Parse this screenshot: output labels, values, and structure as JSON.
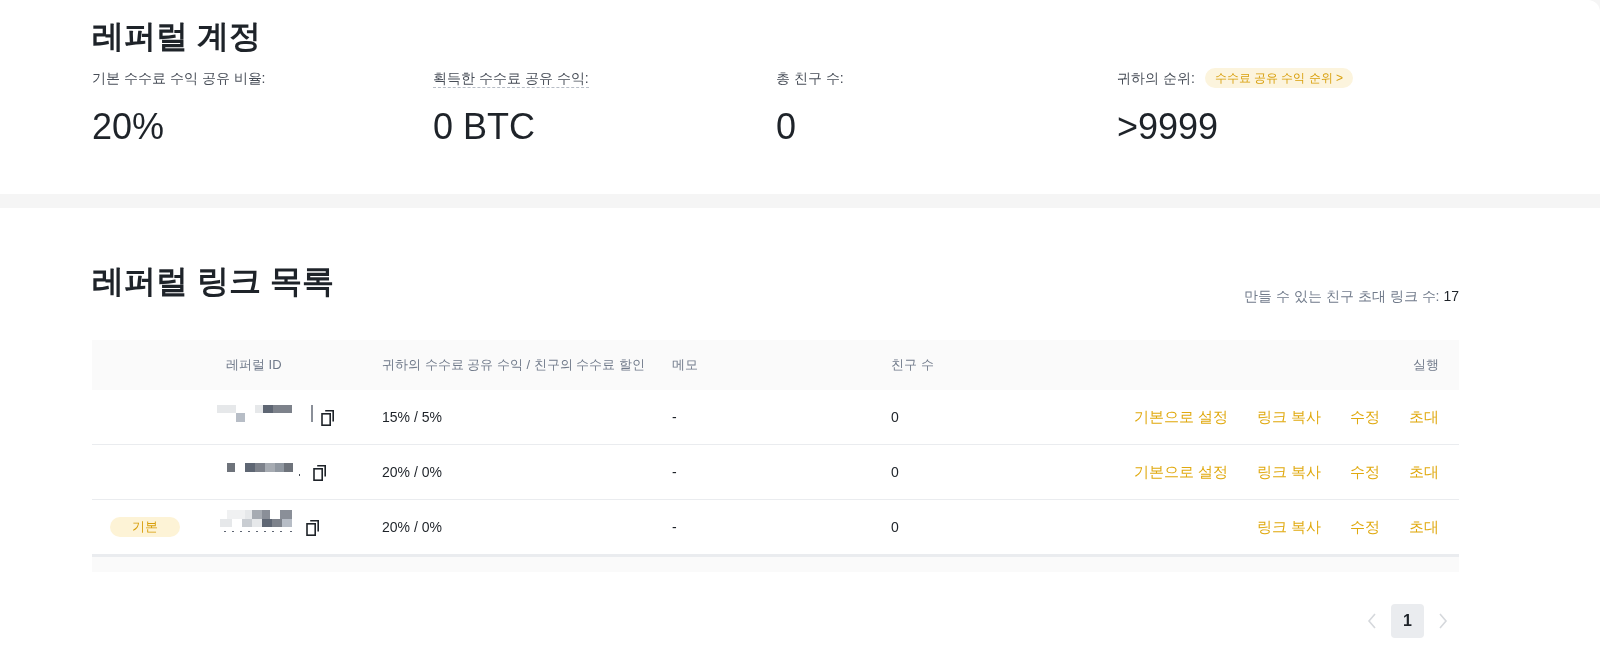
{
  "account": {
    "title": "레퍼럴 계정",
    "stats": [
      {
        "label": "기본 수수료 수익 공유 비율:",
        "value": "20%",
        "underlined": false
      },
      {
        "label": "획득한 수수료 공유 수익:",
        "value": "0 BTC",
        "underlined": true
      },
      {
        "label": "총 친구 수:",
        "value": "0",
        "underlined": false
      },
      {
        "label": "귀하의 순위:",
        "value": ">9999",
        "underlined": false,
        "badge": "수수료 공유 수익 순위 >"
      }
    ]
  },
  "link_list": {
    "title": "레퍼럴 링크 목록",
    "limit_label": "만들 수 있는 친구 초대 링크 수:",
    "limit_value": "17"
  },
  "table": {
    "columns": [
      "레퍼럴 ID",
      "귀하의 수수료 공유 수익 / 친구의 수수료 할인",
      "메모",
      "친구 수",
      "실행"
    ],
    "rows": [
      {
        "rate": "15% / 5%",
        "memo": "-",
        "friends": "0",
        "actions": [
          "기본으로 설정",
          "링크 복사",
          "수정",
          "초대"
        ]
      },
      {
        "rate": "20% / 0%",
        "memo": "-",
        "friends": "0",
        "actions": [
          "기본으로 설정",
          "링크 복사",
          "수정",
          "초대"
        ]
      },
      {
        "tag": "기본",
        "rate": "20% / 0%",
        "memo": "-",
        "friends": "0",
        "actions": [
          "링크 복사",
          "수정",
          "초대"
        ]
      }
    ]
  },
  "pagination": {
    "pages": [
      {
        "label": "1",
        "selected": true
      }
    ],
    "prev_disabled": true,
    "next_disabled": true
  }
}
